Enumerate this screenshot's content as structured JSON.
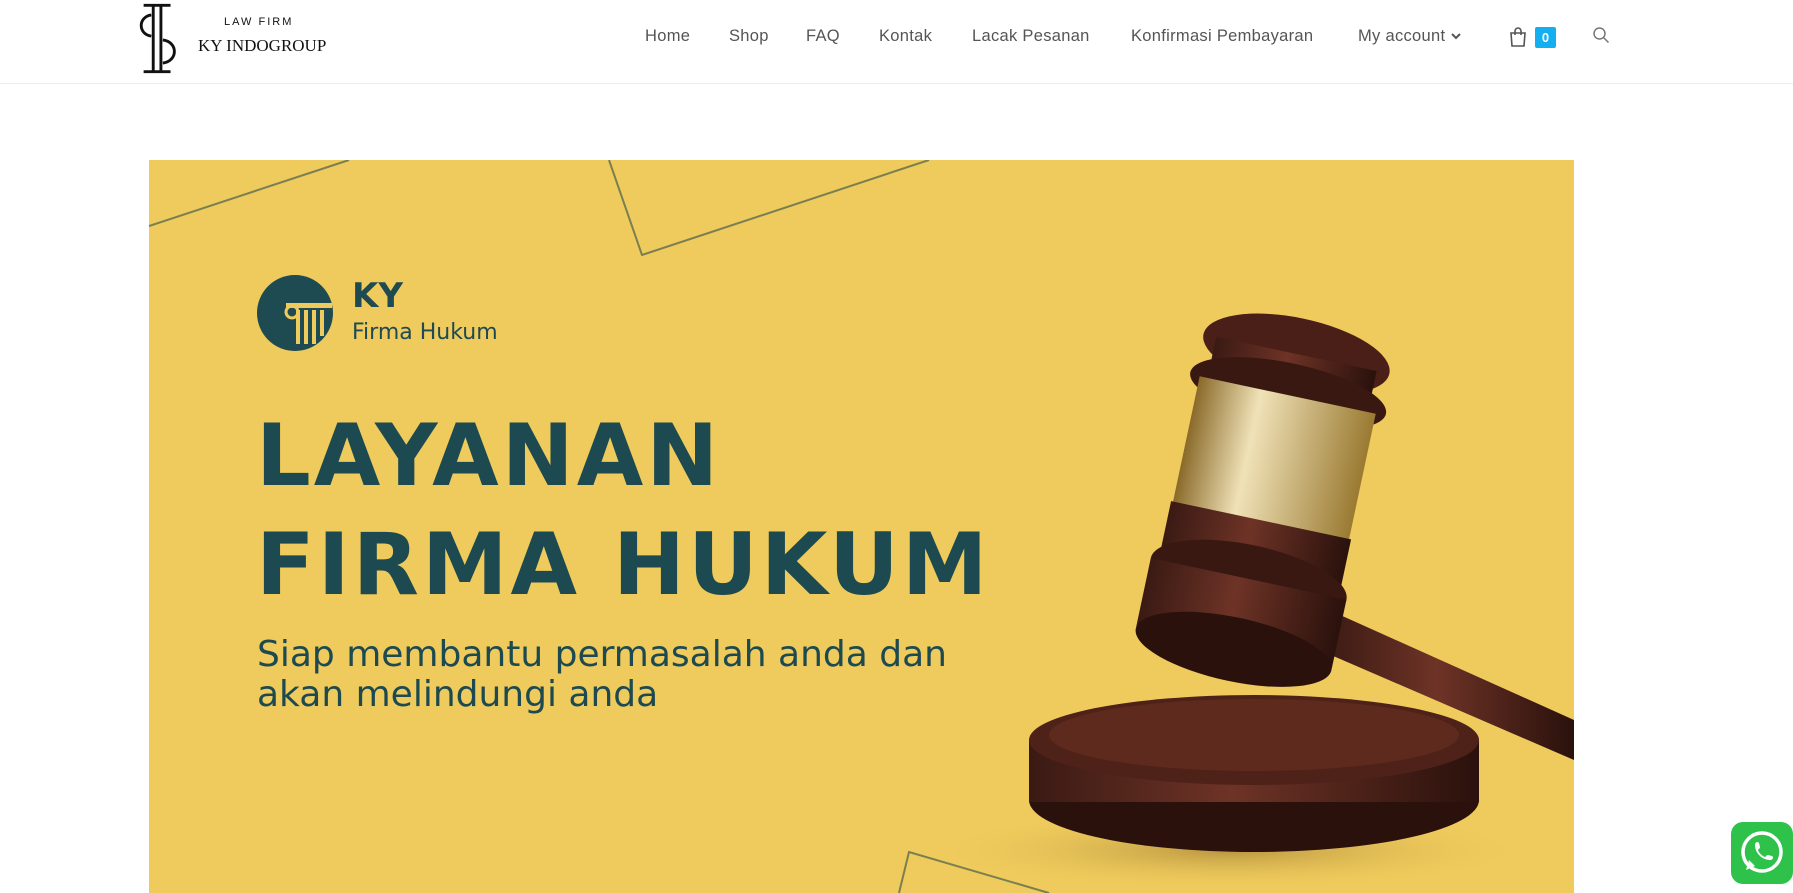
{
  "header": {
    "logo_small": "LAW FIRM",
    "logo_big": "KY INDOGROUP",
    "nav": [
      {
        "label": "Home"
      },
      {
        "label": "Shop"
      },
      {
        "label": "FAQ"
      },
      {
        "label": "Kontak"
      },
      {
        "label": "Lacak Pesanan"
      },
      {
        "label": "Konfirmasi Pembayaran"
      },
      {
        "label": "My account"
      }
    ],
    "cart_count": "0"
  },
  "banner": {
    "brand_name": "KY",
    "brand_sub": "Firma Hukum",
    "headline_line1": "LAYANAN",
    "headline_line2": "FIRMA HUKUM",
    "subtitle_line1": "Siap membantu permasalah anda dan",
    "subtitle_line2": "akan melindungi anda"
  },
  "colors": {
    "banner_bg": "#efca5c",
    "brand_teal": "#1d4a50",
    "cart_badge": "#13aff0",
    "whatsapp": "#2ec24a"
  },
  "icons": [
    "logo-mark",
    "chevron-down-icon",
    "shopping-bag-icon",
    "search-icon",
    "whatsapp-icon",
    "column-icon",
    "gavel-image"
  ]
}
